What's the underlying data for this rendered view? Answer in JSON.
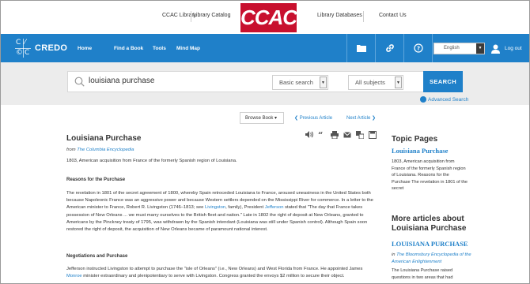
{
  "libbar": {
    "library": "CCAC Library",
    "catalog": "Library Catalog",
    "logo": "CCAC",
    "databases": "Library Databases",
    "contact": "Contact Us"
  },
  "nav": {
    "brand": "CREDO",
    "links": [
      "Home",
      "Find a Book",
      "Tools",
      "Mind Map"
    ],
    "language": "English",
    "logout": "Log out",
    "accent_color": "#1f80c9",
    "icons": [
      "folder-icon",
      "link-icon",
      "help-icon",
      "user-icon"
    ]
  },
  "search": {
    "query": "louisiana purchase",
    "mode": "Basic search",
    "scope": "All subjects",
    "button": "SEARCH",
    "advanced": "Advanced Search"
  },
  "article_nav": {
    "browse": "Browse Book ▾",
    "prev": "❮ Previous Article",
    "next": "Next Article ❯"
  },
  "article": {
    "title": "Louisiana Purchase",
    "from_prefix": "from",
    "source": "The Columbia Encyclopedia",
    "lead": "1803, American acquisition from France of the formerly Spanish region of Louisiana.",
    "sections": [
      {
        "heading": "Reasons for the Purchase",
        "text_a": "The revelation in 1801 of the secret agreement of 1800, whereby Spain retroceded Louisiana to France, aroused uneasiness in the United States both because Napoleonic France was an aggressive power and because Western settlers depended on the Mississippi River for commerce. In a letter to the American minister to France, Robert R. Livingston (1746–1813; see ",
        "link_a": "Livingston",
        "text_b": ", family), President ",
        "link_b": "Jefferson",
        "text_c": " stated that \"The day that France takes possession of New Orleans ... we must marry ourselves to the British fleet and nation.\" Late in 1802 the right of deposit at New Orleans, granted to Americans by the Pinckney treaty of 1795, was withdrawn by the Spanish intendant (Louisiana was still under Spanish control). Although Spain soon restored the right of deposit, the acquisition of New Orleans became of paramount national interest."
      },
      {
        "heading": "Negotiations and Purchase",
        "text_a": "Jefferson instructed Livingston to attempt to purchase the \"isle of Orleans\" (i.e., New Orleans) and West Florida from France. He appointed James ",
        "link_a": "Monroe",
        "text_b": " minister extraordinary and plenipotentiary to serve with Livingston. Congress granted the envoys $2 million to secure their object."
      }
    ]
  },
  "sidebar": {
    "topic_heading": "Topic Pages",
    "topic_link": "Louisiana Purchase",
    "topic_text": "1803, American acquisition from France of the formerly Spanish region of Louisiana. Reasons for the Purchase The revelation in 1801 of the secret",
    "more_heading": "More articles about Louisiana Purchase",
    "more_link": "LOUISIANA PURCHASE",
    "more_in_prefix": "in",
    "more_source": "The Bloomsbury Encyclopedia of the American Enlightenment",
    "more_text": "The Louisiana Purchase raised questions in two areas that had"
  }
}
